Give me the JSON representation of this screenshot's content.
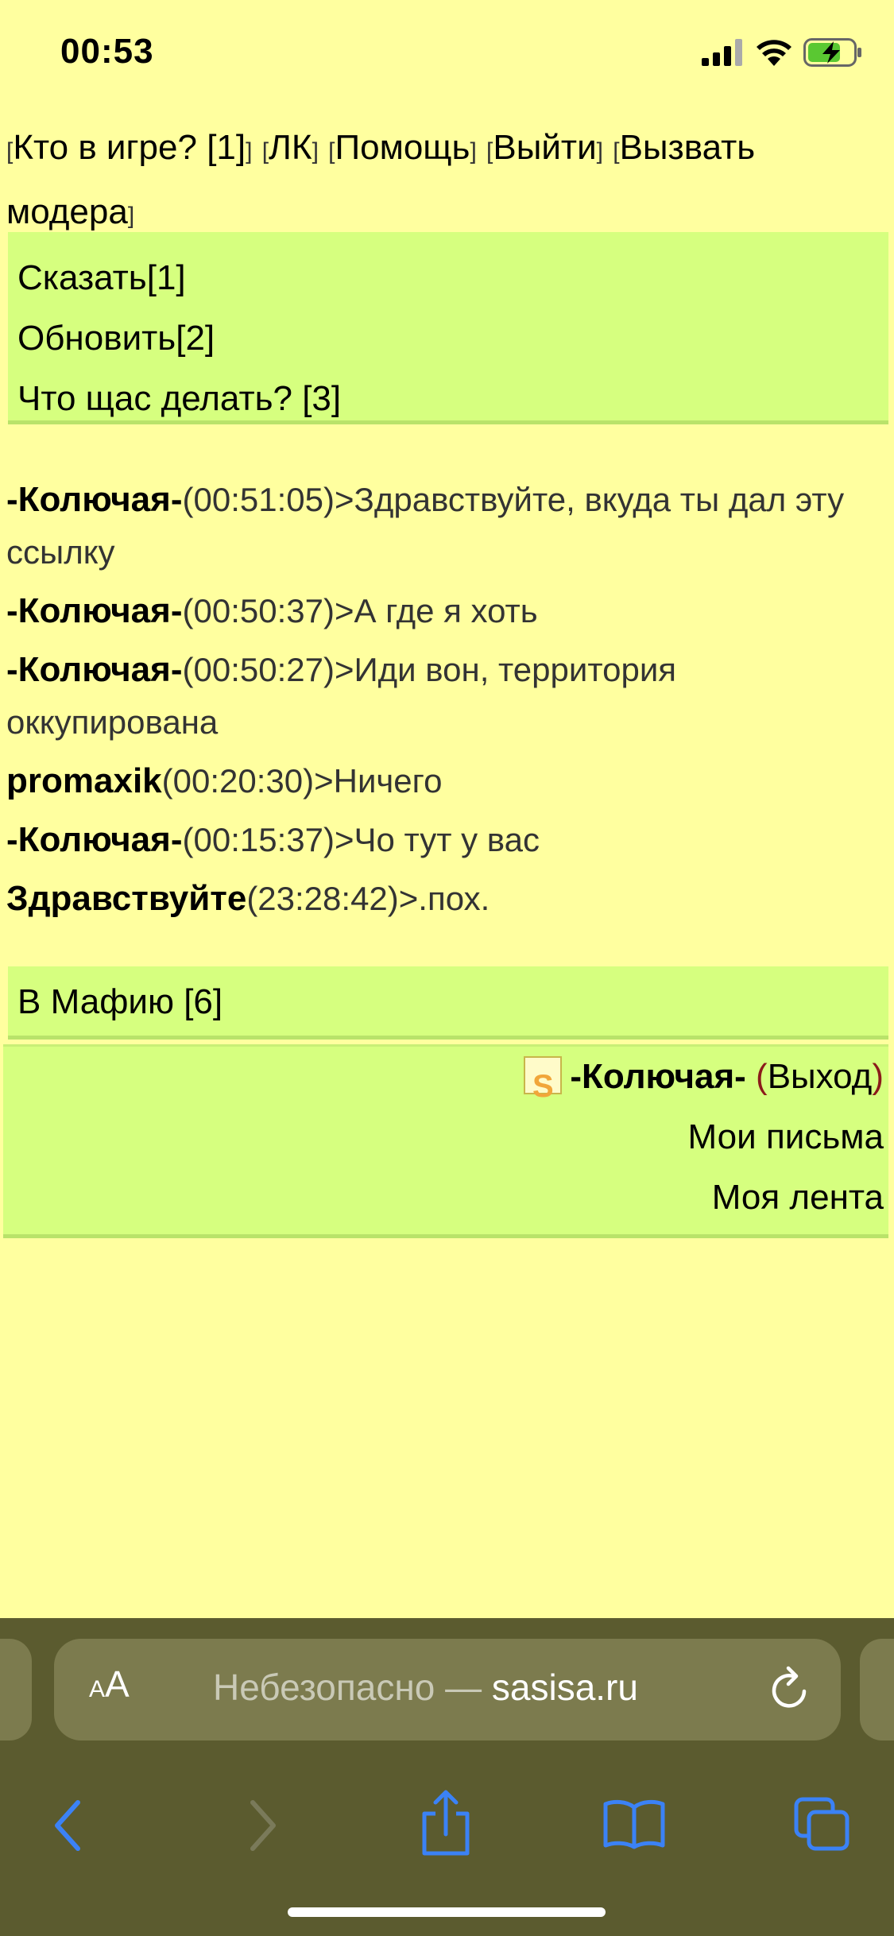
{
  "status": {
    "time": "00:53"
  },
  "top_links": {
    "who": "Кто в игре? [1]",
    "lk": "ЛК",
    "help": "Помощь",
    "logout": "Выйти",
    "call_moder": "Вызвать модера"
  },
  "menu": [
    "Сказать[1]",
    "Обновить[2]",
    "Что щас делать? [3]"
  ],
  "chat": [
    {
      "nick": "-Колючая-",
      "time": "(00:51:05)",
      "text": ">Здравствуйте, вкуда ты дал эту ссылку"
    },
    {
      "nick": "-Колючая-",
      "time": "(00:50:37)",
      "text": ">А где я хоть"
    },
    {
      "nick": "-Колючая-",
      "time": "(00:50:27)",
      "text": ">Иди вон, территория оккупирована"
    },
    {
      "nick": "promaxik",
      "time": "(00:20:30)",
      "text": ">Ничего"
    },
    {
      "nick": "-Колючая-",
      "time": "(00:15:37)",
      "text": ">Чо тут у вас"
    },
    {
      "nick": "Здравствуйте",
      "time": "(23:28:42)",
      "text": ">.пох."
    }
  ],
  "mafia": "В Мафию [6]",
  "user_panel": {
    "badge": "S",
    "nick": "-Колючая-",
    "exit_open": "(",
    "exit": "Выход",
    "exit_close": ")",
    "letters": "Мои письма",
    "feed": "Моя лента"
  },
  "browser": {
    "aa_small": "A",
    "aa_big": "A",
    "url_prefix": "Небезопасно — ",
    "domain": "sasisa.ru"
  },
  "icons": [
    "signal-icon",
    "wifi-icon",
    "battery-charging-icon",
    "reload-icon",
    "back-icon",
    "forward-icon",
    "share-icon",
    "bookmarks-icon",
    "tabs-icon"
  ]
}
